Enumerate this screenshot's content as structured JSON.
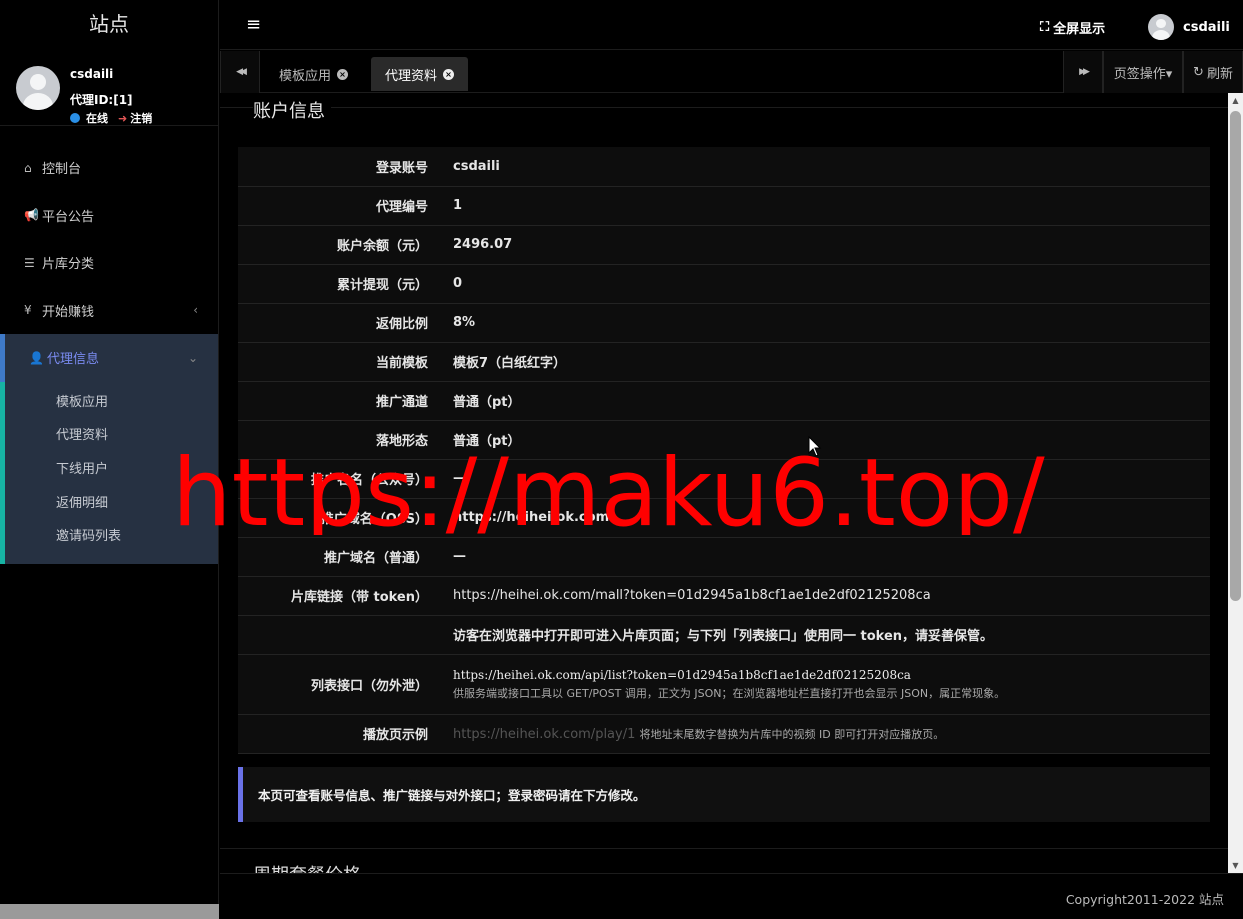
{
  "sidebar": {
    "site_title": "站点",
    "user": {
      "name": "csdaili",
      "agent_id": "代理ID:[1]",
      "online": "在线",
      "logout": "注销"
    },
    "menu": [
      {
        "icon": "home-icon",
        "glyph": "⌂",
        "label": "控制台"
      },
      {
        "icon": "bullhorn-icon",
        "glyph": "📢",
        "label": "平台公告"
      },
      {
        "icon": "list-icon",
        "glyph": "☰",
        "label": "片库分类"
      },
      {
        "icon": "yen-icon",
        "glyph": "¥",
        "label": "开始赚钱",
        "arrow": "‹"
      },
      {
        "icon": "user-icon",
        "glyph": "👤",
        "label": "代理信息",
        "arrow": "⌄",
        "active": true
      }
    ],
    "submenu": [
      "模板应用",
      "代理资料",
      "下线用户",
      "返佣明细",
      "邀请码列表"
    ]
  },
  "topbar": {
    "toggle_glyph": "≡",
    "fullscreen_glyph": "⛶",
    "fullscreen_label": "全屏显示",
    "username": "csdaili"
  },
  "tabbar": {
    "prev_glyph": "◀◀",
    "next_glyph": "▶▶",
    "tabs": [
      {
        "label": "模板应用",
        "active": false
      },
      {
        "label": "代理资料",
        "active": true
      }
    ],
    "close_glyph": "×",
    "page_ops": "页签操作▾",
    "refresh_glyph": "↻",
    "refresh": "刷新"
  },
  "content": {
    "section_title": "账户信息",
    "rows": [
      {
        "key": "登录账号",
        "value": "csdaili"
      },
      {
        "key": "代理编号",
        "value": "1"
      },
      {
        "key": "账户余额（元）",
        "value": "2496.07"
      },
      {
        "key": "累计提现（元）",
        "value": "0"
      },
      {
        "key": "返佣比例",
        "value": "8%"
      },
      {
        "key": "当前模板",
        "value": "模板7（白纸红字）"
      },
      {
        "key": "推广通道",
        "value": "普通（pt）"
      },
      {
        "key": "落地形态",
        "value": "普通（pt）"
      },
      {
        "key": "推广名名（公众号）",
        "value": "—"
      },
      {
        "key": "推广域名（OSS）",
        "value": "https://heihei.ok.com"
      },
      {
        "key": "推广域名（普通）",
        "value": "—"
      },
      {
        "key": "片库链接（带 token）",
        "value": "https://heihei.ok.com/mall?token=01d2945a1b8cf1ae1de2df02125208ca"
      },
      {
        "key": "",
        "value": "访客在浏览器中打开即可进入片库页面；与下列「列表接口」使用同一 token，请妥善保管。"
      },
      {
        "key": "列表接口（勿外泄）",
        "value": "https://heihei.ok.com/api/list?token=01d2945a1b8cf1ae1de2df02125208ca",
        "note": "供服务端或接口工具以 GET/POST 调用，正文为 JSON；在浏览器地址栏直接打开也会显示 JSON，属正常现象。"
      },
      {
        "key": "播放页示例",
        "value": "https://heihei.ok.com/play/1",
        "note": "将地址末尾数字替换为片库中的视频 ID 即可打开对应播放页。"
      }
    ],
    "notice": "本页可查看账号信息、推广链接与对外接口；登录密码请在下方修改。",
    "next_title": "周期套餐价格"
  },
  "footer": {
    "copyright": "Copyright2011-2022 站点"
  },
  "watermark": {
    "text": "https://maku6.top/",
    "color": "#ff0000"
  }
}
